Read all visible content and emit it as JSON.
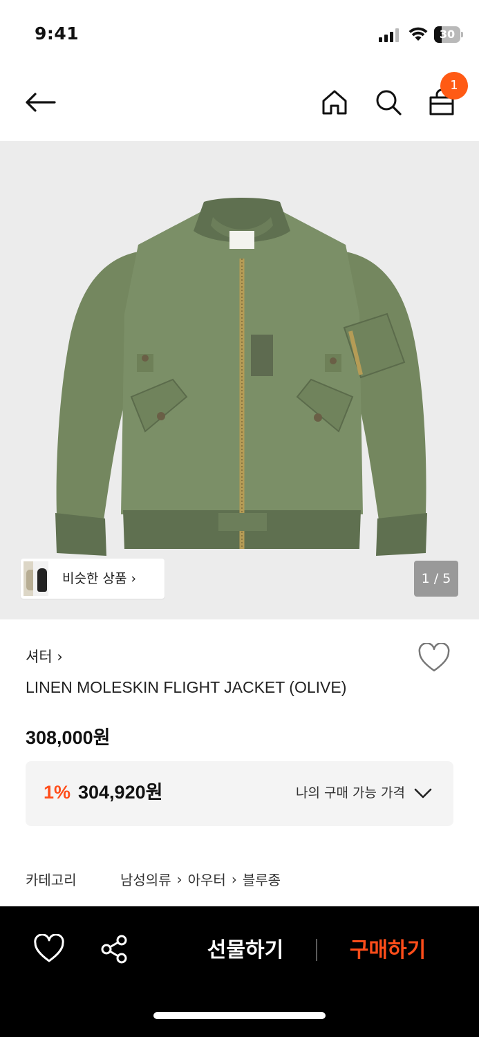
{
  "status_bar": {
    "time": "9:41",
    "battery_percent": "30",
    "battery_level": 0.3
  },
  "nav": {
    "cart_count": "1"
  },
  "gallery": {
    "similar_label": "비슷한 상품 ›",
    "page_indicator": "1 / 5"
  },
  "product": {
    "brand": "셔터 ›",
    "name": "LINEN MOLESKIN FLIGHT JACKET (OLIVE)",
    "price": "308,000원",
    "discount_rate": "1%",
    "my_price": "304,920원",
    "my_price_label": "나의 구매 가능 가격"
  },
  "category": {
    "label": "카테고리",
    "path": [
      "남성의류",
      "아우터",
      "블루종"
    ],
    "separator": "›"
  },
  "bottom_bar": {
    "gift_label": "선물하기",
    "buy_label": "구매하기"
  },
  "colors": {
    "accent": "#ff4d1a",
    "badge": "#ff5a14",
    "jacket": "#7b8f67"
  }
}
